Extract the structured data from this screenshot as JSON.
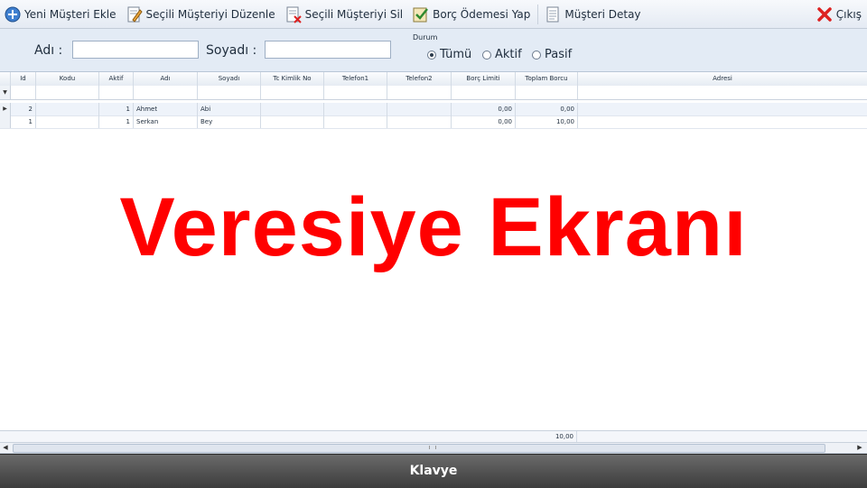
{
  "toolbar": {
    "add_label": "Yeni Müşteri Ekle",
    "edit_label": "Seçili Müşteriyi Düzenle",
    "delete_label": "Seçili Müşteriyi Sil",
    "payment_label": "Borç Ödemesi Yap",
    "detail_label": "Müşteri Detay",
    "exit_label": "Çıkış"
  },
  "filter": {
    "name_label": "Adı :",
    "surname_label": "Soyadı :",
    "name_value": "",
    "surname_value": "",
    "status_title": "Durum",
    "status_options": [
      "Tümü",
      "Aktif",
      "Pasif"
    ],
    "status_selected": "Tümü"
  },
  "grid": {
    "columns": [
      "Id",
      "Kodu",
      "Aktif",
      "Adı",
      "Soyadı",
      "Tc Kimlik No",
      "Telefon1",
      "Telefon2",
      "Borç Limiti",
      "Toplam Borcu",
      "Adresi"
    ],
    "rows": [
      {
        "id": "2",
        "kodu": "",
        "aktif": "1",
        "adi": "Ahmet",
        "soyadi": "Abi",
        "tc": "",
        "tel1": "",
        "tel2": "",
        "limit": "0,00",
        "borc": "0,00",
        "adres": ""
      },
      {
        "id": "1",
        "kodu": "",
        "aktif": "1",
        "adi": "Serkan",
        "soyadi": "Bey",
        "tc": "",
        "tel1": "",
        "tel2": "",
        "limit": "0,00",
        "borc": "10,00",
        "adres": ""
      }
    ],
    "total_borc": "10,00"
  },
  "overlay_title": "Veresiye Ekranı",
  "keyboard_label": "Klavye",
  "colors": {
    "overlay": "#ff0000",
    "accent": "#2f6db5"
  }
}
